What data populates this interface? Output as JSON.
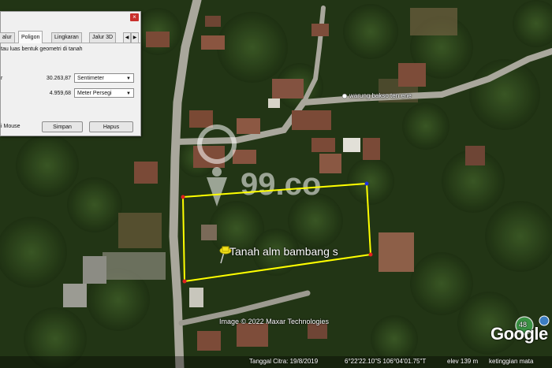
{
  "panel": {
    "tabs": [
      "alur",
      "Poligon",
      "Lingkaran",
      "Jalur 3D"
    ],
    "active_tab": "Poligon",
    "description": "tau luas bentuk geometri di tanah",
    "perimeter_label": "r",
    "perimeter_value": "30.263,87",
    "perimeter_unit": "Sentimeter",
    "area_label": "",
    "area_value": "4.959,68",
    "area_unit": "Meter Persegi",
    "mouse_label": "i Mouse",
    "save_label": "Simpan",
    "delete_label": "Hapus",
    "close_glyph": "×",
    "arrow_left": "◀",
    "arrow_right": "▶"
  },
  "map": {
    "place_label": "warung bakso ten ene",
    "placemark_label": "Tanah alm bambang s",
    "watermark": "99.co",
    "copyright": "Image © 2022 Maxar Technologies",
    "google_logo": "Google",
    "badge": "48",
    "polygon_color": "#ffff00"
  },
  "status_bar": {
    "date": "Tanggal Citra: 19/8/2019",
    "coords": "6°22'22.10\"S  106°04'01.75\"T",
    "elev": "elev  139 m",
    "eye": "ketinggian mata"
  }
}
